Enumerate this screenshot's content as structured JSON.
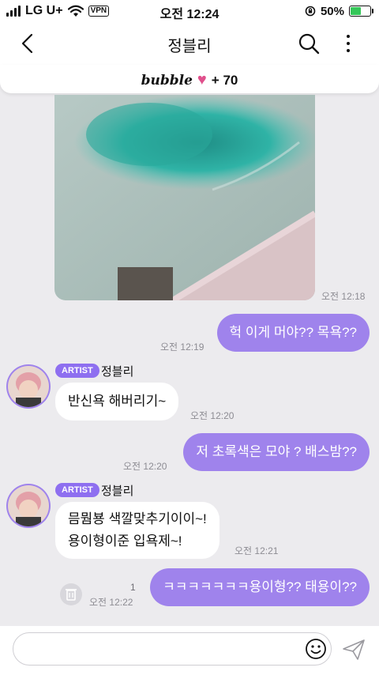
{
  "status_bar": {
    "carrier": "LG U+",
    "vpn": "VPN",
    "time": "오전 12:24",
    "battery_text": "50%",
    "battery_level": 0.5
  },
  "header": {
    "title": "정블리",
    "back_icon": "chevron-left-icon",
    "search_icon": "search-icon",
    "more_icon": "more-vertical-icon"
  },
  "bubble_bar": {
    "label": "bubble",
    "heart": "♥",
    "count": "+ 70"
  },
  "messages": [
    {
      "type": "image",
      "time": "오전 12:18"
    },
    {
      "type": "out",
      "text": "헉 이게 머야?? 목욕??",
      "time": "오전 12:19"
    },
    {
      "type": "in",
      "tag": "ARTIST",
      "sender": "정블리",
      "lines": [
        "반신욕 해버리기~"
      ],
      "time": "오전 12:20"
    },
    {
      "type": "out",
      "text": "저 초록색은 모야 ? 배스밤??",
      "time": "오전 12:20"
    },
    {
      "type": "in",
      "tag": "ARTIST",
      "sender": "정블리",
      "lines": [
        "믐뭠뵹 색깔맞추기이이~!",
        "용이형이준 입욕제~!"
      ],
      "time": "오전 12:21"
    },
    {
      "type": "out",
      "text": "ㅋㅋㅋㅋㅋㅋㅋ용이형?? 태용이??",
      "time": "오전 12:22",
      "unread": "1"
    }
  ],
  "input": {
    "placeholder": ""
  },
  "colors": {
    "accent": "#9f83ec",
    "tag": "#8e6ff0",
    "background": "#ecebee",
    "heart": "#e0508c"
  }
}
